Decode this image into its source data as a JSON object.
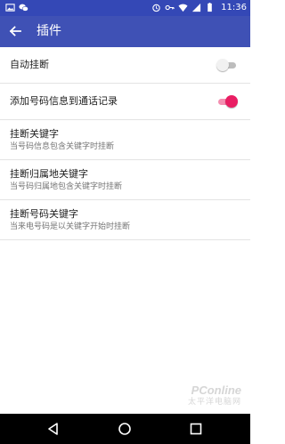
{
  "status_bar": {
    "time": "11:36",
    "left_icons": [
      "image-icon",
      "wechat-icon"
    ],
    "right_icons": [
      "alarm-icon",
      "key-icon",
      "wifi-icon",
      "signal-icon",
      "battery-icon"
    ]
  },
  "app_bar": {
    "title": "插件",
    "back_icon": "arrow-back-icon"
  },
  "settings": {
    "auto_hangup": {
      "label": "自动挂断",
      "enabled": false
    },
    "add_to_call_log": {
      "label": "添加号码信息到通话记录",
      "enabled": true
    },
    "hangup_keyword": {
      "label": "挂断关键字",
      "summary": "当号码信息包含关键字时挂断"
    },
    "hangup_location_keyword": {
      "label": "挂断归属地关键字",
      "summary": "当号码归属地包含关键字时挂断"
    },
    "hangup_number_keyword": {
      "label": "挂断号码关键字",
      "summary": "当来电号码是以关键字开始时挂断"
    }
  },
  "watermark": {
    "brand": "PConline",
    "sub": "太平洋电脑网"
  },
  "nav_bar": {
    "icons": [
      "nav-back-icon",
      "nav-home-icon",
      "nav-recent-icon"
    ]
  },
  "colors": {
    "status_bar": "#3448b6",
    "app_bar": "#3f51b5",
    "switch_on_thumb": "#e91e63",
    "switch_on_track": "#f48fb1",
    "switch_off_thumb": "#f1f1f1",
    "switch_off_track": "#bdbdbd"
  }
}
